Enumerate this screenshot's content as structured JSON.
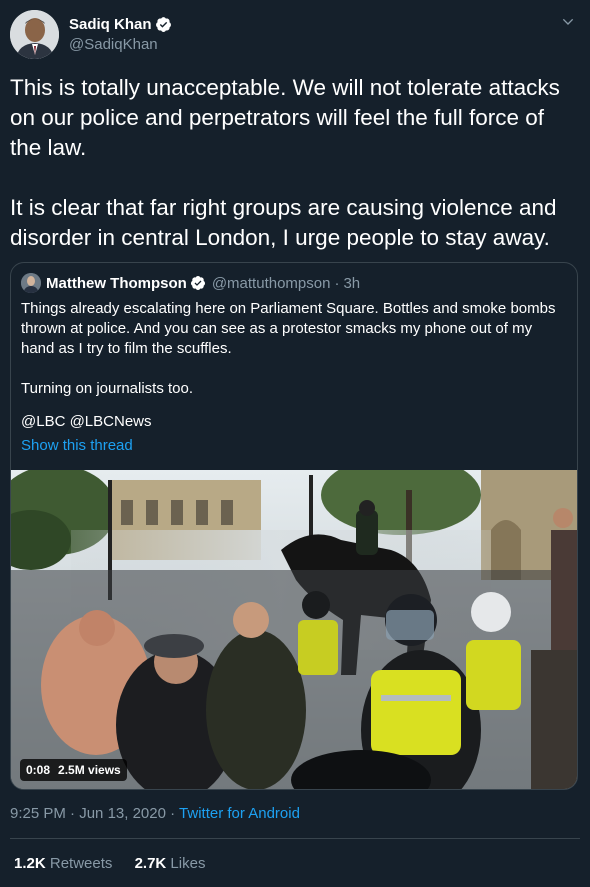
{
  "author": {
    "name": "Sadiq Khan",
    "handle": "@SadiqKhan",
    "verified": true
  },
  "tweet": {
    "paragraphs": [
      "This is totally unacceptable. We will not tolerate attacks on our police and perpetrators will feel the full force of the law.",
      "It is clear that far right groups are causing violence and disorder in central London, I urge people to stay away."
    ]
  },
  "quoted_tweet": {
    "author_name": "Matthew Thompson",
    "author_handle": "@mattuthompson",
    "separator": "·",
    "time": "3h",
    "paragraphs": [
      "Things already escalating here on Parliament Square. Bottles and smoke bombs thrown at police. And you can see as a protestor smacks my phone out of my hand as I try to film the scuffles.",
      "Turning on journalists too.",
      "@LBC @LBCNews"
    ],
    "show_thread_label": "Show this thread",
    "video": {
      "duration": "0:08",
      "views": "2.5M views"
    }
  },
  "meta": {
    "time": "9:25 PM",
    "date": "Jun 13, 2020",
    "separator": "·",
    "source": "Twitter for Android"
  },
  "stats": {
    "retweets_count": "1.2K",
    "retweets_label": "Retweets",
    "likes_count": "2.7K",
    "likes_label": "Likes"
  },
  "colors": {
    "background": "#15202b",
    "text": "#ffffff",
    "secondary_text": "#8899a6",
    "accent": "#1da1f2",
    "border": "#38444d"
  },
  "icons": [
    "verified-badge-icon",
    "chevron-down-icon",
    "avatar-image",
    "video-thumbnail"
  ]
}
